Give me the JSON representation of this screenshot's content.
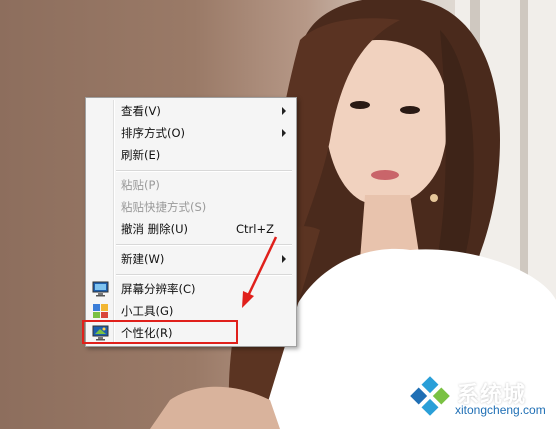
{
  "menu": {
    "items": [
      {
        "label": "查看(V)",
        "has_submenu": true,
        "enabled": true
      },
      {
        "label": "排序方式(O)",
        "has_submenu": true,
        "enabled": true
      },
      {
        "label": "刷新(E)",
        "has_submenu": false,
        "enabled": true
      },
      {
        "label": "粘贴(P)",
        "has_submenu": false,
        "enabled": false
      },
      {
        "label": "粘贴快捷方式(S)",
        "has_submenu": false,
        "enabled": false
      },
      {
        "label": "撤消 删除(U)",
        "shortcut": "Ctrl+Z",
        "has_submenu": false,
        "enabled": true
      },
      {
        "label": "新建(W)",
        "has_submenu": true,
        "enabled": true
      },
      {
        "label": "屏幕分辨率(C)",
        "icon": "screen-resolution-icon",
        "enabled": true
      },
      {
        "label": "小工具(G)",
        "icon": "gadgets-icon",
        "enabled": true
      },
      {
        "label": "个性化(R)",
        "icon": "personalize-icon",
        "enabled": true,
        "highlighted": true
      }
    ]
  },
  "annotation": {
    "highlight_color": "#e0201b",
    "arrow_color": "#e0201b"
  },
  "watermark": {
    "brand_cn": "系统城",
    "brand_en": "xitongcheng.com",
    "logo_colors": [
      "#2a9fd8",
      "#7ac143",
      "#1f6fb5"
    ]
  }
}
